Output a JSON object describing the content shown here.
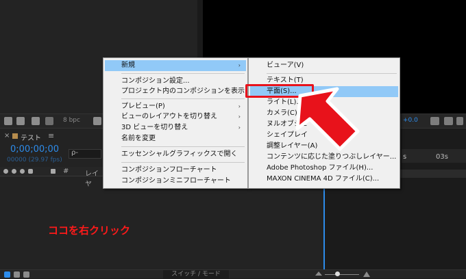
{
  "toolbar": {
    "bpc": "8 bpc",
    "exposure": "+0.0"
  },
  "comp_panel": {
    "close": "×",
    "tab_name": "テスト",
    "tab_menu": "≡",
    "timecode": "0;00;00;00",
    "fps": "00000 (29.97 fps)",
    "search_icon": "ρ-",
    "layer_header": "レイヤ",
    "hash": "#"
  },
  "timeline": {
    "tick_03s": "03s",
    "tick_s": "s"
  },
  "bottom": {
    "switch_mode": "スイッチ / モード"
  },
  "hint": "ココを右クリック",
  "context_menu": {
    "items": [
      {
        "label": "新規",
        "arrow": "›"
      },
      {
        "label": "コンポジション設定..."
      },
      {
        "label": "プロジェクト内のコンポジションを表示"
      },
      {
        "label": "プレビュー(P)",
        "arrow": "›"
      },
      {
        "label": "ビューのレイアウトを切り替え",
        "arrow": "›"
      },
      {
        "label": "3D ビューを切り替え",
        "arrow": "›"
      },
      {
        "label": "名前を変更"
      },
      {
        "label": "エッセンシャルグラフィックスで開く"
      },
      {
        "label": "コンポジションフローチャート"
      },
      {
        "label": "コンポジションミニフローチャート"
      }
    ]
  },
  "submenu": {
    "items": [
      {
        "label": "ビューア(V)"
      },
      {
        "label": "テキスト(T)"
      },
      {
        "label": "平面(S)..."
      },
      {
        "label": "ライト(L)..."
      },
      {
        "label": "カメラ(C)..."
      },
      {
        "label": "ヌルオブジェ"
      },
      {
        "label": "シェイプレイ"
      },
      {
        "label": "調整レイヤー(A)"
      },
      {
        "label": "コンテンツに応じた塗りつぶしレイヤー..."
      },
      {
        "label": "Adobe Photoshop ファイル(H)..."
      },
      {
        "label": "MAXON CINEMA 4D ファイル(C)..."
      }
    ]
  },
  "colors": {
    "accent": "#2d8ceb",
    "highlight": "#91c9f7",
    "callout": "#e8121b"
  }
}
